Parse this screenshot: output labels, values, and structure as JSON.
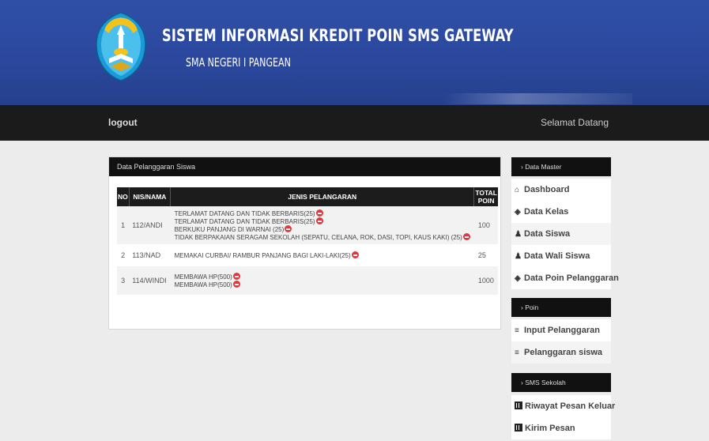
{
  "header": {
    "title": "SISTEM INFORMASI KREDIT POIN SMS GATEWAY",
    "subtitle": "SMA NEGERI I PANGEAN"
  },
  "topbar": {
    "logout": "logout",
    "welcome": "Selamat Datang"
  },
  "panel": {
    "title": "Data Pelanggaran Siswa",
    "columns": [
      "NO",
      "NIS/NAMA",
      "JENIS PELANGARAN",
      "TOTAL POIN"
    ],
    "rows": [
      {
        "no": "1",
        "nis": "112/ANDI",
        "violations": [
          "TERLAMAT DATANG DAN TIDAK BERBARIS(25)",
          "TERLAMAT DATANG DAN TIDAK BERBARIS(25)",
          "BERKUKU PANJANG DI WARNAI (25)",
          "TIDAK BERPAKAIAN SERAGAM SEKOLAH (SEPATU, CELANA, ROK, DASI, TOPI, KAUS KAKI) (25)"
        ],
        "total": "100"
      },
      {
        "no": "2",
        "nis": "113/NAD",
        "violations": [
          "MEMAKAI CURBAI/ RAMBUR PANJANG BAGI LAKI-LAKI(25)"
        ],
        "total": "25"
      },
      {
        "no": "3",
        "nis": "114/WINDI",
        "violations": [
          "MEMBAWA HP(500)",
          "MEMBAWA HP(500)"
        ],
        "total": "1000"
      }
    ]
  },
  "sidebar": {
    "master": {
      "title": "› Data Master",
      "items": [
        {
          "label": "Dashboard",
          "icon": "home-icon"
        },
        {
          "label": "Data Kelas",
          "icon": "tag-icon"
        },
        {
          "label": "Data Siswa",
          "icon": "user-icon"
        },
        {
          "label": "Data Wali Siswa",
          "icon": "user-icon"
        },
        {
          "label": "Data Poin Pelanggaran",
          "icon": "tag-icon"
        }
      ]
    },
    "poin": {
      "title": "› Poin",
      "items": [
        {
          "label": "Input Pelanggaran",
          "icon": "list-icon"
        },
        {
          "label": "Pelanggaran siswa",
          "icon": "list-icon"
        }
      ]
    },
    "sms": {
      "title": "› SMS Sekolah",
      "items": [
        {
          "label": "Riwayat Pesan Keluar",
          "icon": "calculator-icon"
        },
        {
          "label": "Kirim Pesan",
          "icon": "calculator-icon"
        }
      ]
    }
  },
  "colors": {
    "header_bg": "#2b489e",
    "bar_bg": "#1b1b1b",
    "delete_icon": "#e2383d"
  }
}
